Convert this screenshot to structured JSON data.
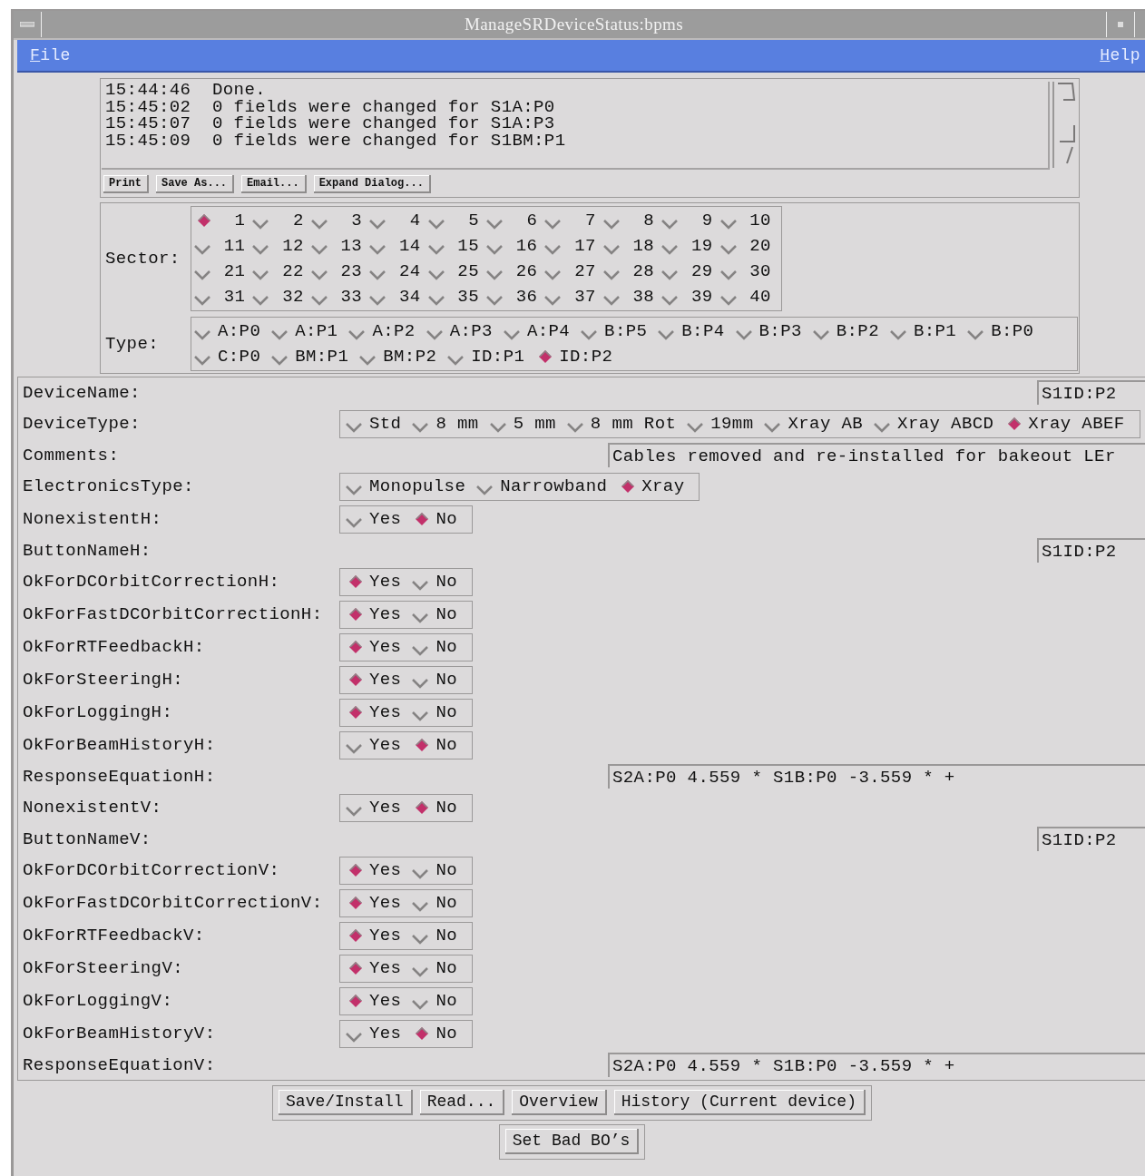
{
  "window": {
    "title": "ManageSRDeviceStatus:bpms"
  },
  "menu": [
    {
      "label": "File"
    },
    {
      "label": "Help"
    }
  ],
  "log": {
    "lines": [
      {
        "time": "15:44:46",
        "message": "Done."
      },
      {
        "time": "15:45:02",
        "message": "0 fields were changed for S1A:P0"
      },
      {
        "time": "15:45:07",
        "message": "0 fields were changed for S1A:P3"
      },
      {
        "time": "15:45:09",
        "message": "0 fields were changed for S1BM:P1"
      }
    ],
    "buttons": [
      "Print",
      "Save As...",
      "Email...",
      "Expand Dialog..."
    ]
  },
  "sector": {
    "label": "Sector:",
    "options": [
      {
        "label": "1",
        "selected": true
      },
      {
        "label": "2",
        "selected": false
      },
      {
        "label": "3",
        "selected": false
      },
      {
        "label": "4",
        "selected": false
      },
      {
        "label": "5",
        "selected": false
      },
      {
        "label": "6",
        "selected": false
      },
      {
        "label": "7",
        "selected": false
      },
      {
        "label": "8",
        "selected": false
      },
      {
        "label": "9",
        "selected": false
      },
      {
        "label": "10",
        "selected": false
      },
      {
        "label": "11",
        "selected": false
      },
      {
        "label": "12",
        "selected": false
      },
      {
        "label": "13",
        "selected": false
      },
      {
        "label": "14",
        "selected": false
      },
      {
        "label": "15",
        "selected": false
      },
      {
        "label": "16",
        "selected": false
      },
      {
        "label": "17",
        "selected": false
      },
      {
        "label": "18",
        "selected": false
      },
      {
        "label": "19",
        "selected": false
      },
      {
        "label": "20",
        "selected": false
      },
      {
        "label": "21",
        "selected": false
      },
      {
        "label": "22",
        "selected": false
      },
      {
        "label": "23",
        "selected": false
      },
      {
        "label": "24",
        "selected": false
      },
      {
        "label": "25",
        "selected": false
      },
      {
        "label": "26",
        "selected": false
      },
      {
        "label": "27",
        "selected": false
      },
      {
        "label": "28",
        "selected": false
      },
      {
        "label": "29",
        "selected": false
      },
      {
        "label": "30",
        "selected": false
      },
      {
        "label": "31",
        "selected": false
      },
      {
        "label": "32",
        "selected": false
      },
      {
        "label": "33",
        "selected": false
      },
      {
        "label": "34",
        "selected": false
      },
      {
        "label": "35",
        "selected": false
      },
      {
        "label": "36",
        "selected": false
      },
      {
        "label": "37",
        "selected": false
      },
      {
        "label": "38",
        "selected": false
      },
      {
        "label": "39",
        "selected": false
      },
      {
        "label": "40",
        "selected": false
      }
    ]
  },
  "type": {
    "label": "Type:",
    "rows": [
      {
        "options": [
          {
            "label": "A:P0",
            "selected": false
          },
          {
            "label": "A:P1",
            "selected": false
          },
          {
            "label": "A:P2",
            "selected": false
          },
          {
            "label": "A:P3",
            "selected": false
          },
          {
            "label": "A:P4",
            "selected": false
          },
          {
            "label": "B:P5",
            "selected": false
          },
          {
            "label": "B:P4",
            "selected": false
          },
          {
            "label": "B:P3",
            "selected": false
          },
          {
            "label": "B:P2",
            "selected": false
          },
          {
            "label": "B:P1",
            "selected": false
          },
          {
            "label": "B:P0",
            "selected": false
          }
        ]
      },
      {
        "options": [
          {
            "label": "C:P0",
            "selected": false
          },
          {
            "label": "BM:P1",
            "selected": false
          },
          {
            "label": "BM:P2",
            "selected": false
          },
          {
            "label": "ID:P1",
            "selected": false
          },
          {
            "label": "ID:P2",
            "selected": true
          }
        ]
      }
    ]
  },
  "fields": [
    {
      "kind": "name",
      "label": "DeviceName:",
      "value": "S1ID:P2"
    },
    {
      "kind": "radio",
      "label": "DeviceType:",
      "options": [
        {
          "label": "Std",
          "selected": false
        },
        {
          "label": "8 mm",
          "selected": false
        },
        {
          "label": "5 mm",
          "selected": false
        },
        {
          "label": "8 mm Rot",
          "selected": false
        },
        {
          "label": "19mm",
          "selected": false
        },
        {
          "label": "Xray AB",
          "selected": false
        },
        {
          "label": "Xray ABCD",
          "selected": false
        },
        {
          "label": "Xray ABEF",
          "selected": true
        }
      ]
    },
    {
      "kind": "text",
      "label": "Comments:",
      "value": "Cables removed and re-installed for bakeout LEr"
    },
    {
      "kind": "radio",
      "label": "ElectronicsType:",
      "options": [
        {
          "label": "Monopulse",
          "selected": false
        },
        {
          "label": "Narrowband",
          "selected": false
        },
        {
          "label": "Xray",
          "selected": true
        }
      ]
    },
    {
      "kind": "radio",
      "label": "NonexistentH:",
      "options": [
        {
          "label": "Yes",
          "selected": false
        },
        {
          "label": "No",
          "selected": true
        }
      ]
    },
    {
      "kind": "name",
      "label": "ButtonNameH:",
      "value": "S1ID:P2"
    },
    {
      "kind": "radio",
      "label": "OkForDCOrbitCorrectionH:",
      "options": [
        {
          "label": "Yes",
          "selected": true
        },
        {
          "label": "No",
          "selected": false
        }
      ]
    },
    {
      "kind": "radio",
      "label": "OkForFastDCOrbitCorrectionH:",
      "options": [
        {
          "label": "Yes",
          "selected": true
        },
        {
          "label": "No",
          "selected": false
        }
      ]
    },
    {
      "kind": "radio",
      "label": "OkForRTFeedbackH:",
      "options": [
        {
          "label": "Yes",
          "selected": true
        },
        {
          "label": "No",
          "selected": false
        }
      ]
    },
    {
      "kind": "radio",
      "label": "OkForSteeringH:",
      "options": [
        {
          "label": "Yes",
          "selected": true
        },
        {
          "label": "No",
          "selected": false
        }
      ]
    },
    {
      "kind": "radio",
      "label": "OkForLoggingH:",
      "options": [
        {
          "label": "Yes",
          "selected": true
        },
        {
          "label": "No",
          "selected": false
        }
      ]
    },
    {
      "kind": "radio",
      "label": "OkForBeamHistoryH:",
      "options": [
        {
          "label": "Yes",
          "selected": false
        },
        {
          "label": "No",
          "selected": true
        }
      ]
    },
    {
      "kind": "text",
      "label": "ResponseEquationH:",
      "value": "S2A:P0 4.559 * S1B:P0 -3.559 * +"
    },
    {
      "kind": "radio",
      "label": "NonexistentV:",
      "options": [
        {
          "label": "Yes",
          "selected": false
        },
        {
          "label": "No",
          "selected": true
        }
      ]
    },
    {
      "kind": "name",
      "label": "ButtonNameV:",
      "value": "S1ID:P2"
    },
    {
      "kind": "radio",
      "label": "OkForDCOrbitCorrectionV:",
      "options": [
        {
          "label": "Yes",
          "selected": true
        },
        {
          "label": "No",
          "selected": false
        }
      ]
    },
    {
      "kind": "radio",
      "label": "OkForFastDCOrbitCorrectionV:",
      "options": [
        {
          "label": "Yes",
          "selected": true
        },
        {
          "label": "No",
          "selected": false
        }
      ]
    },
    {
      "kind": "radio",
      "label": "OkForRTFeedbackV:",
      "options": [
        {
          "label": "Yes",
          "selected": true
        },
        {
          "label": "No",
          "selected": false
        }
      ]
    },
    {
      "kind": "radio",
      "label": "OkForSteeringV:",
      "options": [
        {
          "label": "Yes",
          "selected": true
        },
        {
          "label": "No",
          "selected": false
        }
      ]
    },
    {
      "kind": "radio",
      "label": "OkForLoggingV:",
      "options": [
        {
          "label": "Yes",
          "selected": true
        },
        {
          "label": "No",
          "selected": false
        }
      ]
    },
    {
      "kind": "radio",
      "label": "OkForBeamHistoryV:",
      "options": [
        {
          "label": "Yes",
          "selected": false
        },
        {
          "label": "No",
          "selected": true
        }
      ]
    },
    {
      "kind": "text",
      "label": "ResponseEquationV:",
      "value": "S2A:P0 4.559 * S1B:P0 -3.559 * +"
    }
  ],
  "actions": [
    {
      "buttons": [
        "Save/Install",
        "Read...",
        "Overview",
        "History (Current device)"
      ]
    },
    {
      "buttons": [
        "Set Bad BO’s"
      ]
    }
  ]
}
